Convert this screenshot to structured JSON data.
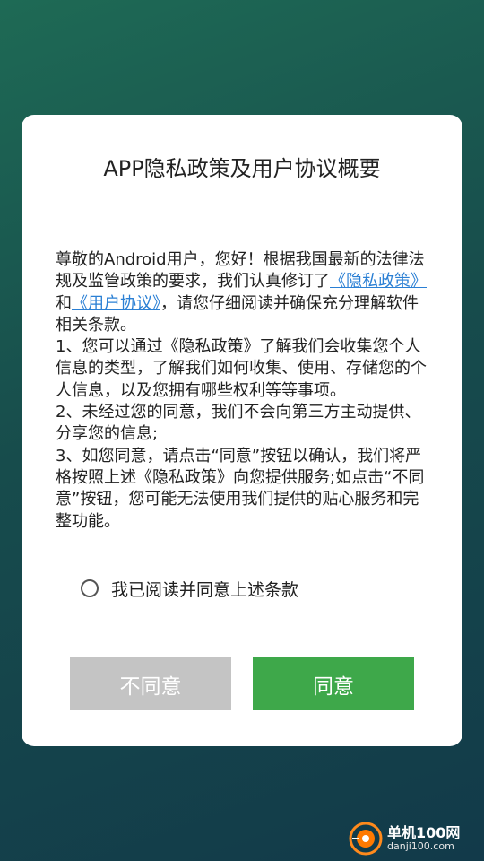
{
  "dialog": {
    "title": "APP隐私政策及用户协议概要",
    "paragraphs": {
      "p1_before": "尊敬的Android用户，您好！根据我国最新的法律法规及监管政策的要求，我们认真修订了",
      "p1_link_privacy": "《隐私政策》",
      "p1_and": "和",
      "p1_link_agreement": "《用户协议》",
      "p1_after": "，请您仔细阅读并确保充分理解软件相关条款。",
      "p2": "1、您可以通过《隐私政策》了解我们会收集您个人信息的类型，了解我们如何收集、使用、存储您的个人信息，以及您拥有哪些权利等等事项。",
      "p3": "2、未经过您的同意，我们不会向第三方主动提供、分享您的信息;",
      "p4": "3、如您同意，请点击“同意”按钮以确认，我们将严格按照上述《隐私政策》向您提供服务;如点击“不同意”按钮，您可能无法使用我们提供的贴心服务和完整功能。"
    },
    "agree_checkbox": {
      "label": "我已阅读并同意上述条款",
      "checked": false
    },
    "buttons": {
      "disagree": "不同意",
      "agree": "同意"
    }
  },
  "watermark": {
    "name": "单机100网",
    "domain": "danji100.com"
  },
  "colors": {
    "link": "#2a7fd4",
    "agree_button": "#3ea84a",
    "disagree_button": "#c4c4c4",
    "background": "#174c4c"
  }
}
